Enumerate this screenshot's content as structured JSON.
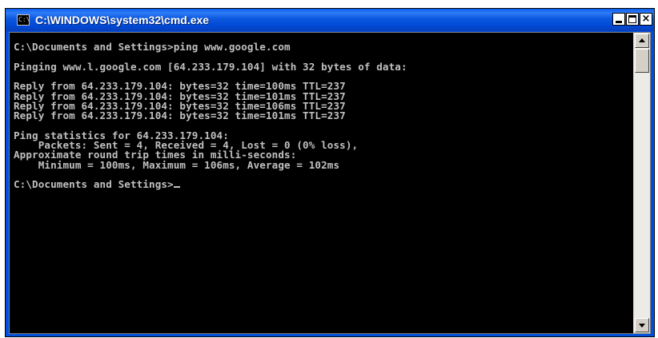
{
  "window": {
    "title": "C:\\WINDOWS\\system32\\cmd.exe",
    "icon": "cmd-icon",
    "icon_text": "C:\\",
    "controls": {
      "minimize": "minimize-icon",
      "maximize": "maximize-icon",
      "close": "×"
    }
  },
  "console": {
    "lines": [
      "C:\\Documents and Settings>ping www.google.com",
      "",
      "Pinging www.l.google.com [64.233.179.104] with 32 bytes of data:",
      "",
      "Reply from 64.233.179.104: bytes=32 time=100ms TTL=237",
      "Reply from 64.233.179.104: bytes=32 time=101ms TTL=237",
      "Reply from 64.233.179.104: bytes=32 time=106ms TTL=237",
      "Reply from 64.233.179.104: bytes=32 time=101ms TTL=237",
      "",
      "Ping statistics for 64.233.179.104:",
      "    Packets: Sent = 4, Received = 4, Lost = 0 (0% loss),",
      "Approximate round trip times in milli-seconds:",
      "    Minimum = 100ms, Maximum = 106ms, Average = 102ms",
      "",
      "C:\\Documents and Settings>"
    ],
    "text_color": "#c0c0c0",
    "background_color": "#000000"
  },
  "scrollbar": {
    "up_icon": "scroll-up-arrow-icon",
    "down_icon": "scroll-down-arrow-icon"
  },
  "colors": {
    "titlebar": "#0054e3",
    "close_button": "#ffffff"
  }
}
